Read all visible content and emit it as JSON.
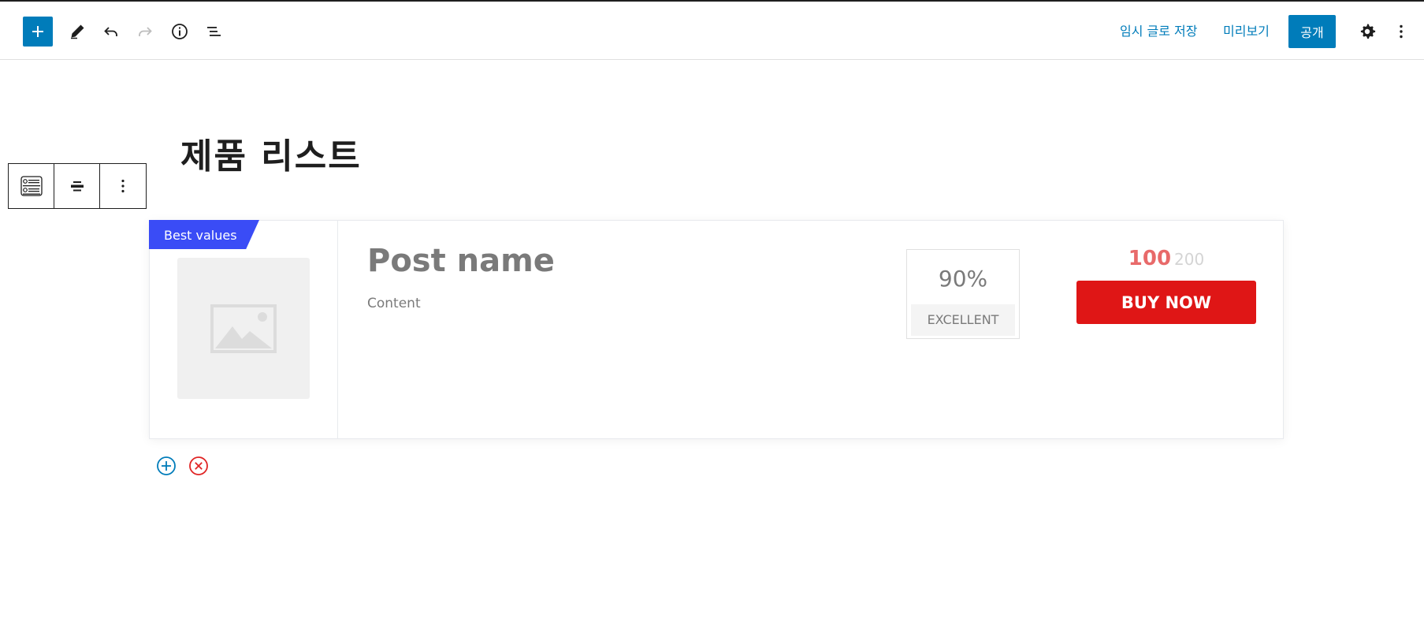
{
  "topbar": {
    "add_icon": "plus-icon",
    "tools_icon": "pencil-icon",
    "undo_icon": "undo-icon",
    "redo_icon": "redo-icon",
    "info_icon": "info-icon",
    "list_view_icon": "list-view-icon",
    "save_draft_label": "임시 글로 저장",
    "preview_label": "미리보기",
    "publish_label": "공개",
    "settings_icon": "gear-icon",
    "more_icon": "vertical-ellipsis-icon"
  },
  "page": {
    "title": "제품 리스트"
  },
  "block_toolbar": {
    "block_type_icon": "product-list-block-icon",
    "align_icon": "align-center-icon",
    "options_icon": "vertical-ellipsis-icon"
  },
  "product": {
    "ribbon": "Best values",
    "image_icon": "image-placeholder-icon",
    "name": "Post name",
    "content": "Content",
    "score": "90%",
    "score_label": "EXCELLENT",
    "price": "100",
    "old_price": "200",
    "buy_label": "BUY NOW"
  },
  "row_actions": {
    "add_icon": "add-circle-icon",
    "remove_icon": "remove-circle-icon"
  },
  "colors": {
    "accent": "#007cba",
    "ribbon": "#3a4cf6",
    "buy_button": "#df1616",
    "price": "#e86a6a",
    "remove": "#e02424"
  }
}
